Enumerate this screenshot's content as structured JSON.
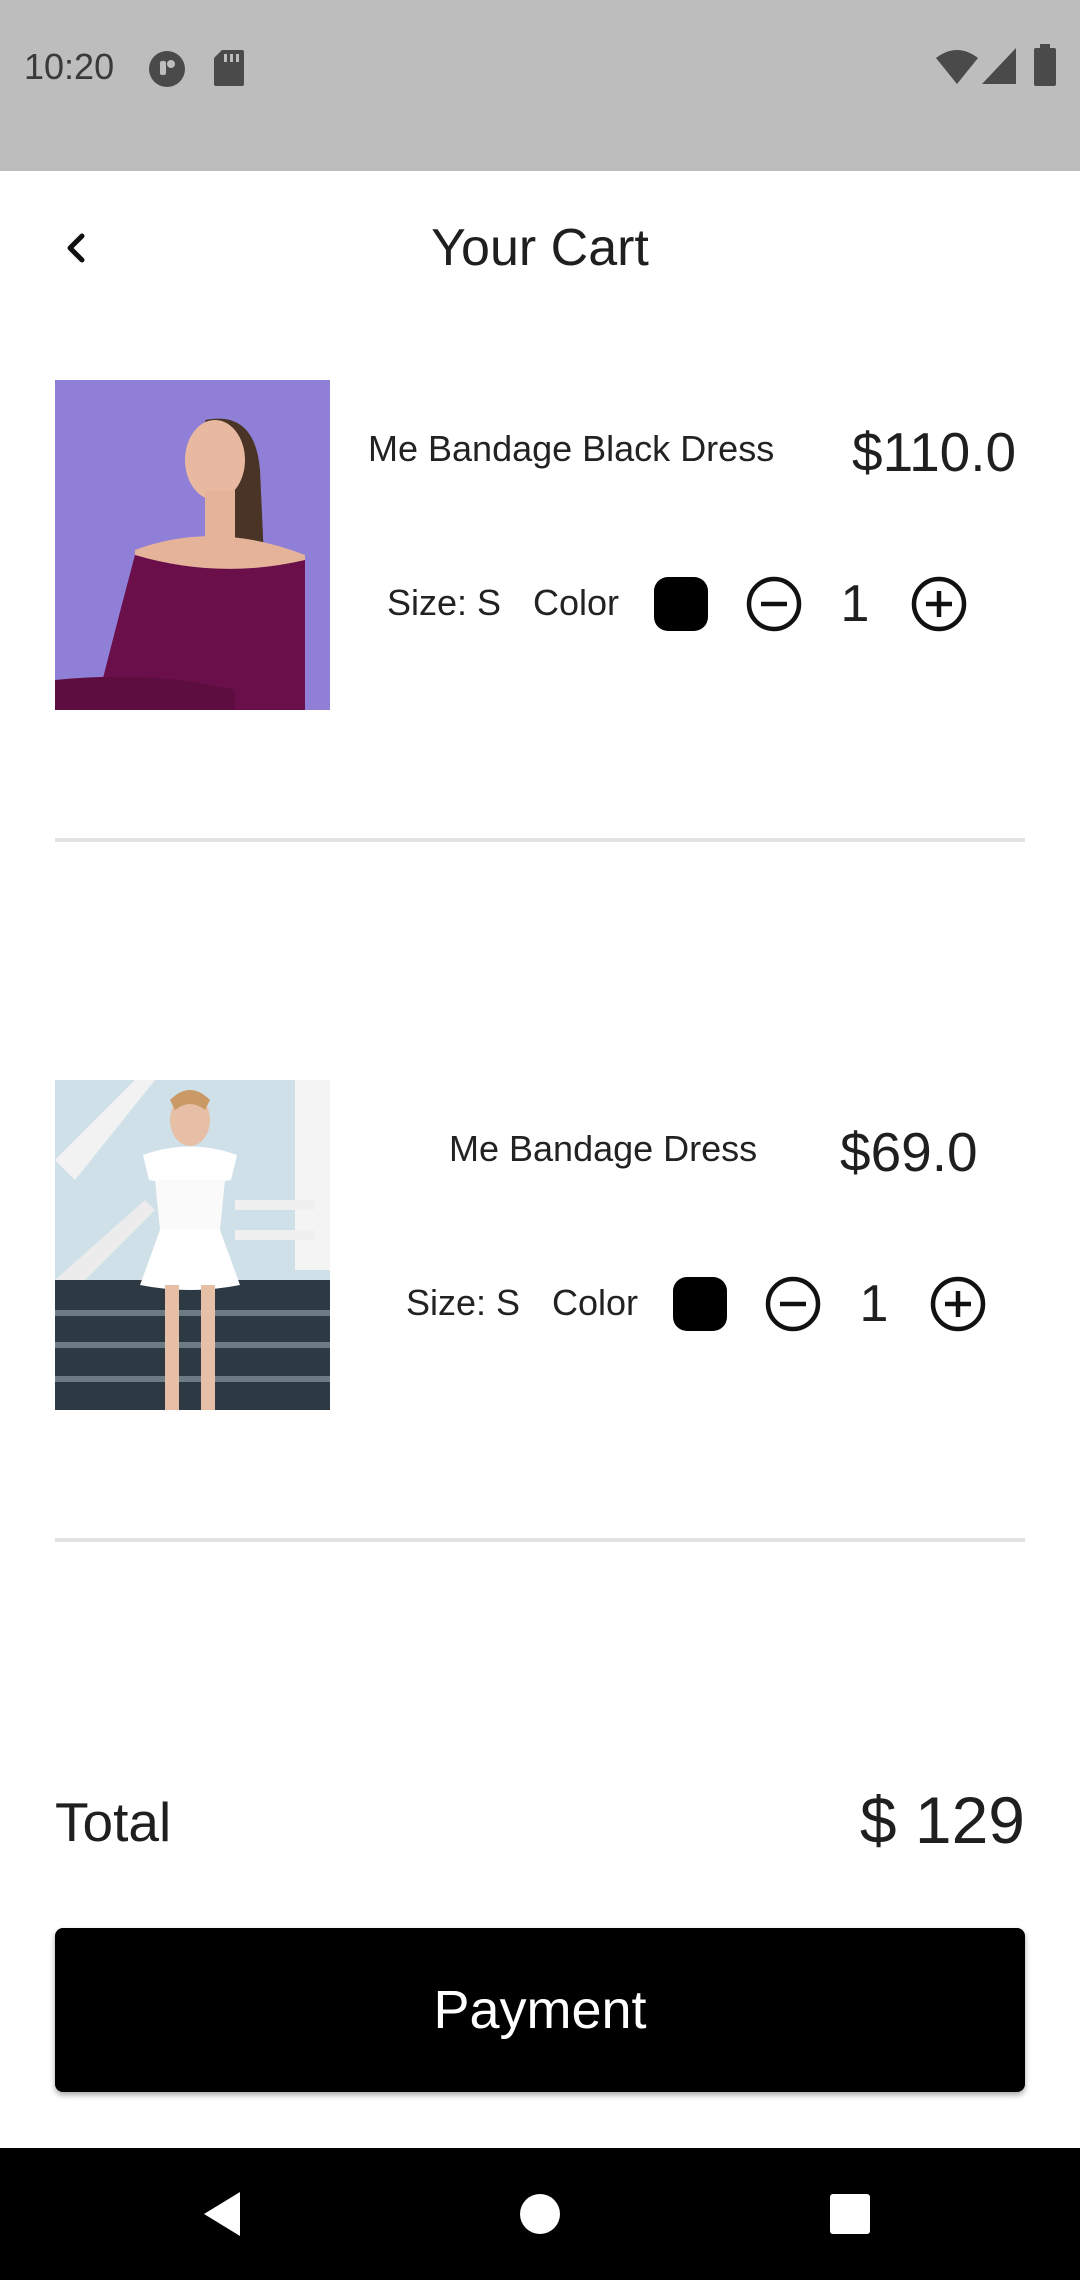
{
  "status_bar": {
    "time": "10:20",
    "icons": [
      "media-icon",
      "sd-card-icon",
      "wifi-icon",
      "signal-icon",
      "battery-icon"
    ]
  },
  "header": {
    "title": "Your Cart",
    "back_icon": "chevron-left-icon"
  },
  "cart": {
    "items": [
      {
        "name": "Me Bandage Black Dress",
        "price": "$110.0",
        "size_label": "Size: S",
        "color_label": "Color",
        "color": "#000000",
        "quantity": "1",
        "image": "woman-in-purple-off-shoulder-dress"
      },
      {
        "name": "Me Bandage  Dress",
        "price": "$69.0",
        "size_label": "Size: S",
        "color_label": "Color",
        "color": "#000000",
        "quantity": "1",
        "image": "woman-in-white-dress-on-stairs"
      }
    ]
  },
  "summary": {
    "total_label": "Total",
    "total_value": "$ 129"
  },
  "actions": {
    "payment_label": "Payment"
  },
  "nav": {
    "icons": [
      "back-triangle-icon",
      "home-circle-icon",
      "recents-square-icon"
    ]
  },
  "colors": {
    "status_bar_bg": "#bdbdbd",
    "button_bg": "#000000",
    "divider": "#e2e2e2",
    "image1_bg": "#8f7fd6",
    "image2_sky": "#cfe0e8"
  }
}
